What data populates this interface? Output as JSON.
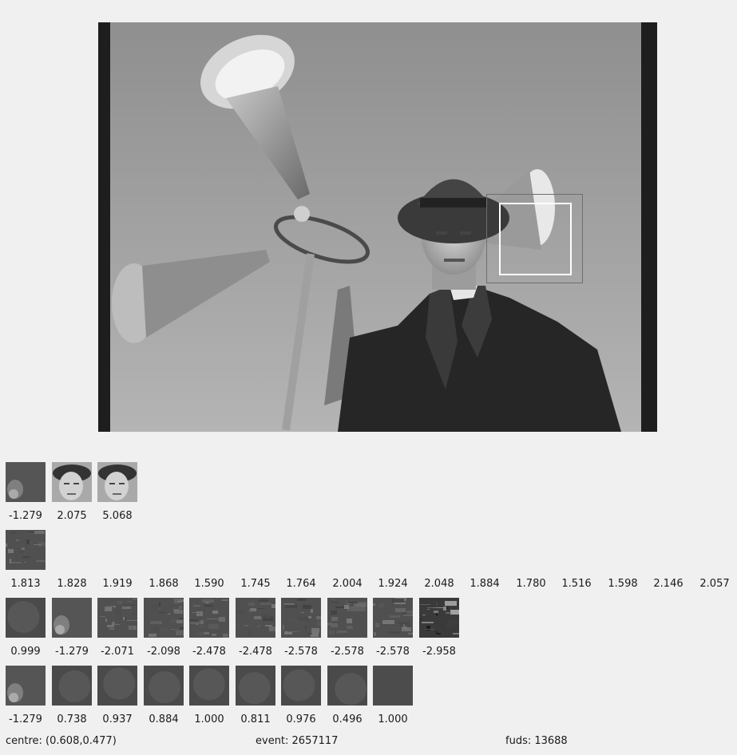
{
  "main_image": {
    "icon": "film-still-man-with-horn-loudspeakers"
  },
  "rows": [
    {
      "thumbs": [
        "blurred-face-patch",
        "face-crop",
        "face-crop"
      ],
      "values": [
        "-1.279",
        "2.075",
        "5.068"
      ]
    },
    {
      "thumbs": [
        "texture-patch"
      ],
      "values": [
        "1.813",
        "1.828",
        "1.919",
        "1.868",
        "1.590",
        "1.745",
        "1.764",
        "2.004",
        "1.924",
        "2.048",
        "1.884",
        "1.780",
        "1.516",
        "1.598",
        "2.146",
        "2.057"
      ]
    },
    {
      "thumbs": [
        "blurred-patch",
        "blurred-face-patch",
        "texture-patch",
        "texture-patch",
        "texture-patch",
        "texture-patch",
        "texture-patch",
        "texture-patch",
        "texture-patch",
        "high-contrast-texture-patch"
      ],
      "values": [
        "0.999",
        "-1.279",
        "-2.071",
        "-2.098",
        "-2.478",
        "-2.478",
        "-2.578",
        "-2.578",
        "-2.578",
        "-2.958"
      ]
    },
    {
      "thumbs": [
        "blurred-face-patch",
        "blurred-patch",
        "blurred-patch",
        "blurred-patch",
        "blurred-patch",
        "blurred-patch",
        "blurred-patch",
        "blurred-patch",
        "flat-patch"
      ],
      "values": [
        "-1.279",
        "0.738",
        "0.937",
        "0.884",
        "1.000",
        "0.811",
        "0.976",
        "0.496",
        "1.000"
      ]
    }
  ],
  "status": {
    "centre": "centre: (0.608,0.477)",
    "event": "event: 2657117",
    "fuds": "fuds: 13688"
  }
}
